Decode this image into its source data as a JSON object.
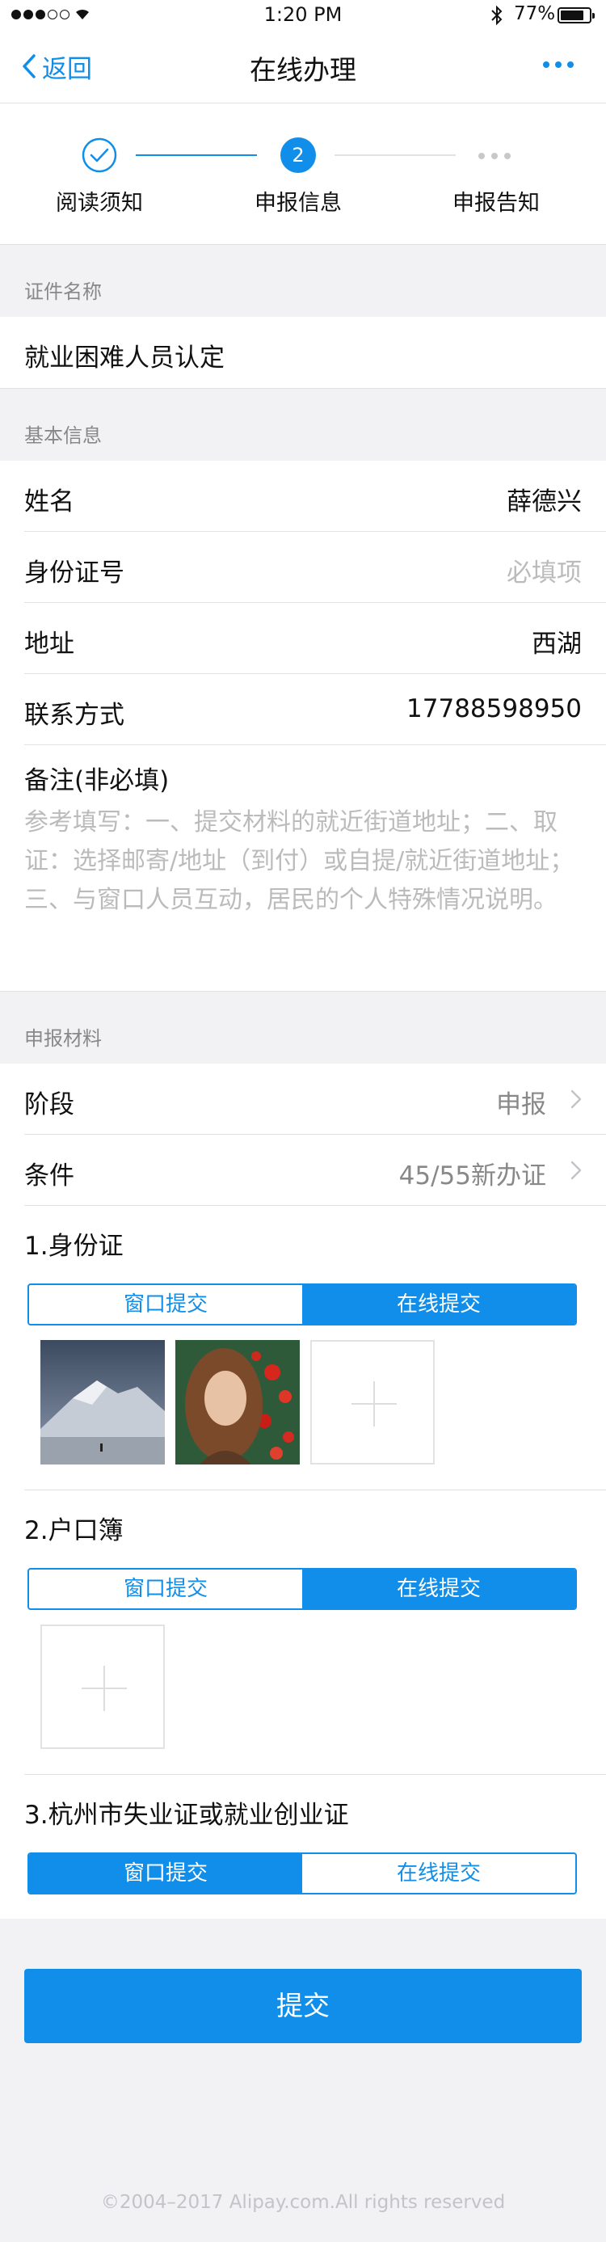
{
  "status": {
    "time": "1:20 PM",
    "battery": "77%"
  },
  "nav": {
    "back": "返回",
    "title": "在线办理",
    "more_icon": "more-dots-icon"
  },
  "steps": [
    {
      "label": "阅读须知",
      "state": "done"
    },
    {
      "label": "申报信息",
      "number": "2",
      "state": "current"
    },
    {
      "label": "申报告知",
      "state": "todo"
    }
  ],
  "cert": {
    "header": "证件名称",
    "value": "就业困难人员认定"
  },
  "basic": {
    "header": "基本信息",
    "rows": [
      {
        "label": "姓名",
        "value": "薛德兴"
      },
      {
        "label": "身份证号",
        "placeholder": "必填项"
      },
      {
        "label": "地址",
        "value": "西湖"
      },
      {
        "label": "联系方式",
        "value": "17788598950"
      }
    ],
    "remark_label": "备注(非必填)",
    "remark_placeholder": "参考填写：一、提交材料的就近街道地址；二、取证：选择邮寄/地址（到付）或自提/就近街道地址；三、与窗口人员互动，居民的个人特殊情况说明。"
  },
  "materials": {
    "header": "申报材料",
    "stage": {
      "label": "阶段",
      "value": "申报"
    },
    "condition": {
      "label": "条件",
      "value": "45/55新办证"
    },
    "items": [
      {
        "title": "1.身份证",
        "seg": [
          "窗口提交",
          "在线提交"
        ],
        "active": 1
      },
      {
        "title": "2.户口簿",
        "seg": [
          "窗口提交",
          "在线提交"
        ],
        "active": 1
      },
      {
        "title": "3.杭州市失业证或就业创业证",
        "seg": [
          "窗口提交",
          "在线提交"
        ],
        "active": 0
      }
    ]
  },
  "submit": "提交",
  "footer": "©2004–2017 Alipay.com.All rights reserved",
  "colors": {
    "accent": "#108ee9",
    "background": "#f2f2f5"
  }
}
